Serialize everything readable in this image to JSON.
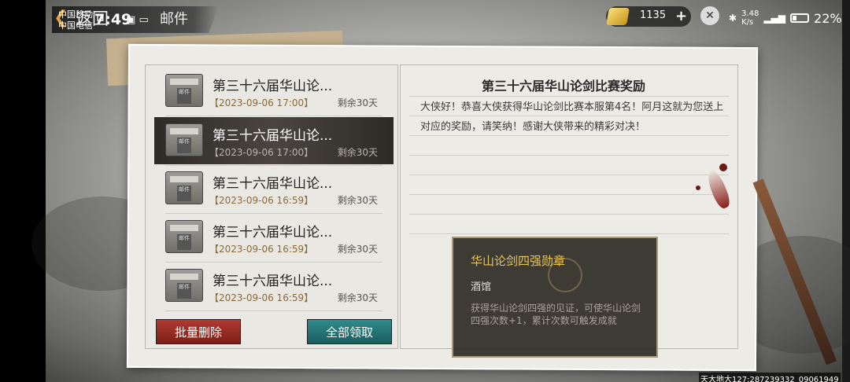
{
  "status_bar": {
    "carrier_1": "中国移动",
    "carrier_2": "中国电信",
    "time": "7:49",
    "net_speed": "3.48",
    "net_unit": "K/s",
    "battery": "22%"
  },
  "header": {
    "back_label": "返回",
    "title": "邮件"
  },
  "currency": {
    "gold": "1135",
    "plus": "+"
  },
  "mail_list": [
    {
      "title": "第三十六届华山论...",
      "date": "【2023-09-06 17:00】",
      "remain": "剩余30天",
      "selected": false
    },
    {
      "title": "第三十六届华山论...",
      "date": "【2023-09-06 17:00】",
      "remain": "剩余30天",
      "selected": true
    },
    {
      "title": "第三十六届华山论...",
      "date": "【2023-09-06 16:59】",
      "remain": "剩余30天",
      "selected": false
    },
    {
      "title": "第三十六届华山论...",
      "date": "【2023-09-06 16:59】",
      "remain": "剩余30天",
      "selected": false
    },
    {
      "title": "第三十六届华山论...",
      "date": "【2023-09-06 16:59】",
      "remain": "剩余30天",
      "selected": false
    }
  ],
  "mail_icon_label": "邮件",
  "buttons": {
    "delete_all": "批量删除",
    "claim_all": "全部领取"
  },
  "detail": {
    "title": "第三十六届华山论剑比赛奖励",
    "body": "大侠好！恭喜大侠获得华山论剑比赛本服第4名！阿月这就为您送上对应的奖励，请笑纳！感谢大侠带来的精彩对决！"
  },
  "tooltip": {
    "name": "华山论剑四强勋章",
    "type": "酒馆",
    "description": "获得华山论剑四强的见证，可使华山论剑四强次数+1，累计次数可触发成就"
  },
  "server_info": "天大地大127:287239332_09061949",
  "colors": {
    "accent_gold": "#e8c657",
    "delete_red": "#b13a2f",
    "claim_teal": "#2f8a8c",
    "selected_dark": "#2d2a26"
  }
}
